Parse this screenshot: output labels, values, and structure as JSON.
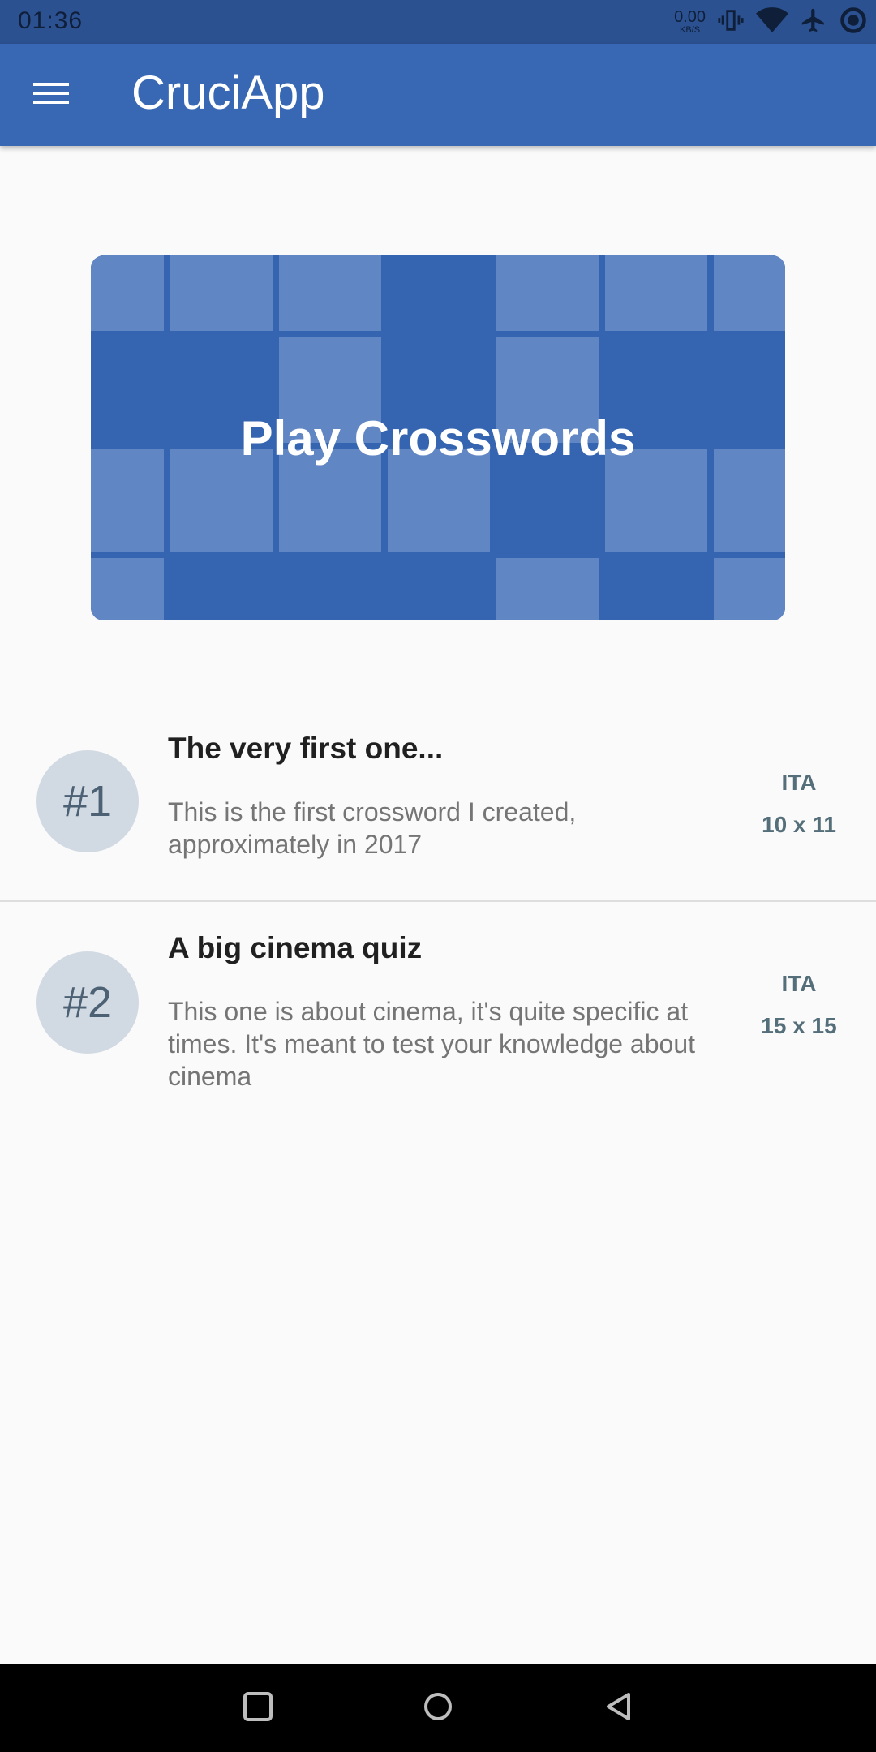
{
  "status_bar": {
    "time": "01:36",
    "net_speed_value": "0.00",
    "net_speed_unit": "KB/S",
    "icons": [
      "vibrate-icon",
      "wifi-icon",
      "airplane-icon",
      "sync-icon"
    ]
  },
  "app_bar": {
    "title": "CruciApp",
    "menu_icon": "menu-icon"
  },
  "banner": {
    "label": "Play Crosswords"
  },
  "crosswords": [
    {
      "number": "#1",
      "title": "The very first one...",
      "description": "This is the first crossword I created, approximately in 2017",
      "language": "ITA",
      "size": "10 x 11"
    },
    {
      "number": "#2",
      "title": "A big cinema quiz",
      "description": "This one is about cinema, it's quite specific at times. It's meant to test your knowledge about cinema",
      "language": "ITA",
      "size": "15 x 15"
    }
  ],
  "nav_bar": {
    "buttons": [
      "recents-icon",
      "home-icon",
      "back-icon"
    ]
  },
  "colors": {
    "primary": "#3867b3",
    "status_bar": "#2c5190",
    "avatar_bg": "#d1d9e2",
    "meta_text": "#546e7a"
  }
}
